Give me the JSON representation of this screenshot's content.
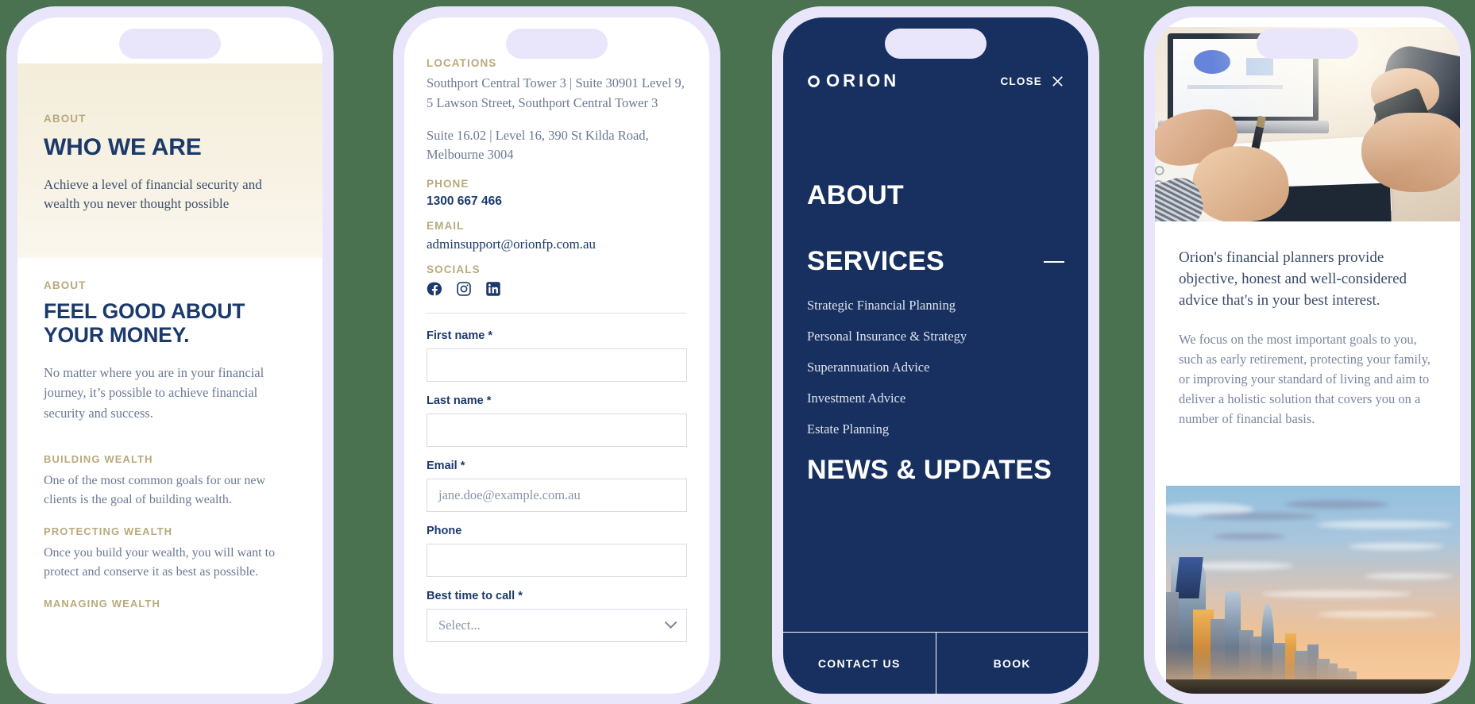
{
  "brand": {
    "name": "ORION",
    "navy": "#17305f",
    "gold": "#b9a97c",
    "deep_blue": "#1b3a6b"
  },
  "phone1": {
    "hero": {
      "eyebrow": "ABOUT",
      "heading": "WHO WE ARE",
      "subtext": "Achieve a level of financial security and wealth you never thought possible"
    },
    "section": {
      "eyebrow": "ABOUT",
      "heading": "FEEL GOOD ABOUT YOUR MONEY.",
      "lead": "No matter where you are in your financial journey, it’s possible to achieve financial security and success.",
      "blocks": [
        {
          "title": "BUILDING WEALTH",
          "text": "One of the most common goals for our new clients is the goal of building wealth."
        },
        {
          "title": "PROTECTING WEALTH",
          "text": "Once you build your wealth, you will want to protect and conserve it as best as possible."
        },
        {
          "title": "MANAGING WEALTH",
          "text": ""
        }
      ]
    }
  },
  "phone2": {
    "locations_label": "LOCATIONS",
    "addresses": [
      "Southport Central Tower 3 | Suite 30901 Level 9, 5 Lawson Street, Southport Central Tower 3",
      "Suite 16.02 | Level 16, 390 St Kilda Road, Melbourne 3004"
    ],
    "phone_label": "PHONE",
    "phone_value": "1300 667 466",
    "email_label": "EMAIL",
    "email_value": "adminsupport@orionfp.com.au",
    "socials_label": "SOCIALS",
    "socials": [
      {
        "icon": "facebook-icon",
        "name": "Facebook"
      },
      {
        "icon": "instagram-icon",
        "name": "Instagram"
      },
      {
        "icon": "linkedin-icon",
        "name": "LinkedIn"
      }
    ],
    "form": {
      "fields": [
        {
          "label": "First name *",
          "value": "",
          "placeholder": "",
          "type": "text"
        },
        {
          "label": "Last name *",
          "value": "",
          "placeholder": "",
          "type": "text"
        },
        {
          "label": "Email *",
          "value": "",
          "placeholder": "jane.doe@example.com.au",
          "type": "email"
        },
        {
          "label": "Phone",
          "value": "",
          "placeholder": "",
          "type": "tel"
        },
        {
          "label": "Best time to call *",
          "value": "Select...",
          "placeholder": "Select...",
          "type": "select"
        }
      ]
    }
  },
  "phone3": {
    "logo": "ORION",
    "close_label": "CLOSE",
    "menu": [
      {
        "label": "ABOUT",
        "expanded": false,
        "children": []
      },
      {
        "label": "SERVICES",
        "expanded": true,
        "children": [
          "Strategic Financial Planning",
          "Personal Insurance & Strategy",
          "Superannuation Advice",
          "Investment Advice",
          "Estate Planning"
        ]
      },
      {
        "label": "NEWS & UPDATES",
        "expanded": false,
        "children": []
      }
    ],
    "footer": [
      {
        "label": "CONTACT US"
      },
      {
        "label": "BOOK"
      }
    ]
  },
  "phone4": {
    "top_photo": "office-meeting-photo",
    "lede": "Orion's financial planners provide objective, honest and well-considered advice that's in your best interest.",
    "body": "We focus on the most important goals to you, such as early retirement, protecting your family, or improving your standard of living and aim to deliver a holistic solution that covers you on a number of financial basis.",
    "bottom_photo": "city-skyline-sunset-photo"
  }
}
